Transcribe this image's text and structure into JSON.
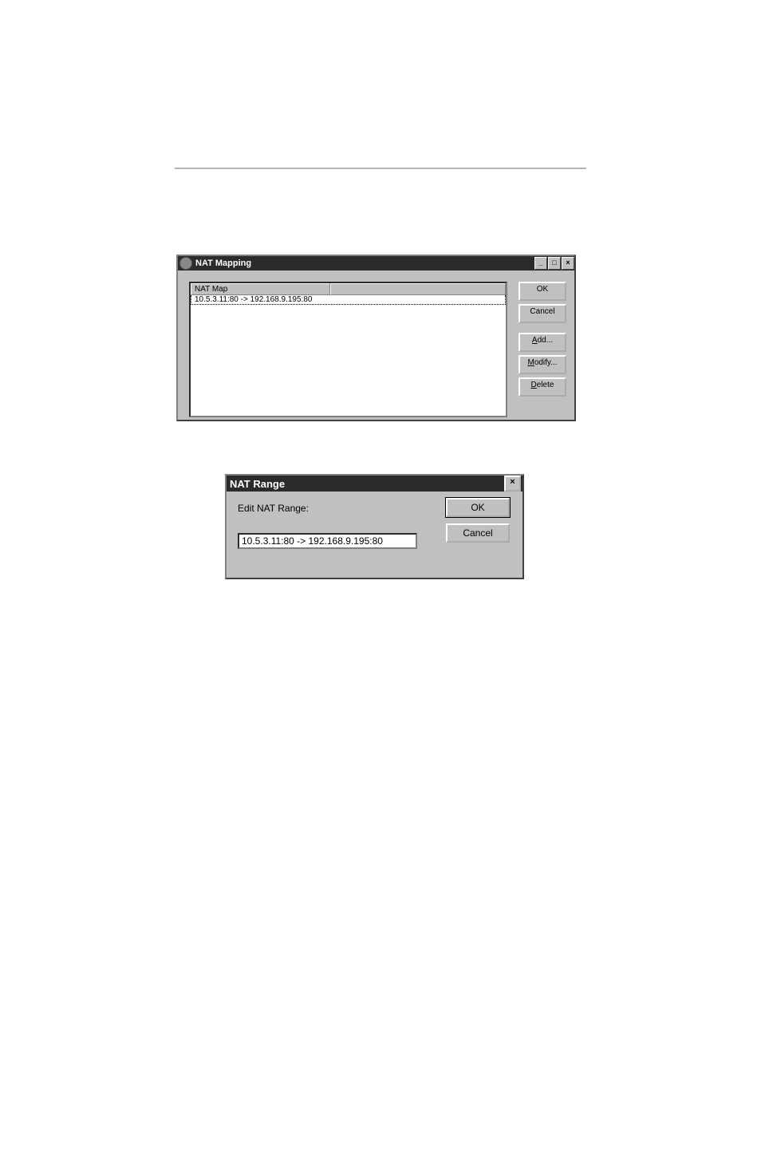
{
  "dialog1": {
    "title": "NAT Mapping",
    "list_header": "NAT Map",
    "list_rows": [
      "10.5.3.11:80 -> 192.168.9.195:80"
    ],
    "buttons": {
      "ok": "OK",
      "cancel": "Cancel",
      "add": "Add...",
      "modify": "Modify...",
      "delete": "Delete"
    }
  },
  "dialog2": {
    "title": "NAT Range",
    "label": "Edit NAT Range:",
    "input_value": "10.5.3.11:80 -> 192.168.9.195:80",
    "ok": "OK",
    "cancel": "Cancel"
  }
}
